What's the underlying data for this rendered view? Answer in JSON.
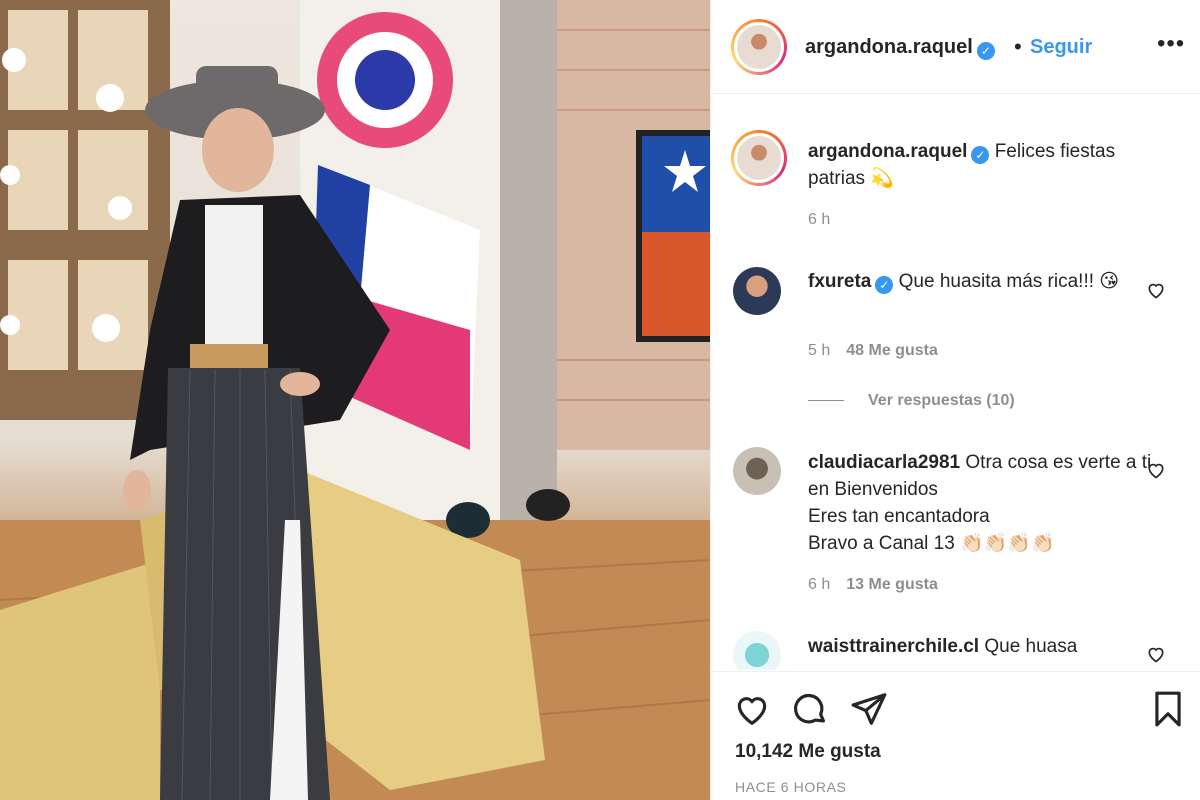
{
  "post": {
    "username": "argandona.raquel",
    "verified": true,
    "follow_label": "Seguir",
    "more_label": "•••",
    "dot": "•"
  },
  "caption": {
    "username": "argandona.raquel",
    "text": "Felices fiestas patrias 💫",
    "time": "6 h"
  },
  "comments": [
    {
      "username": "fxureta",
      "verified": true,
      "text": "Que huasita más rica!!! 😘",
      "time": "5 h",
      "likes": "48 Me gusta"
    },
    {
      "username": "claudiacarla2981",
      "verified": false,
      "text": "Otra cosa es verte a ti en Bienvenidos\nEres tan encantadora\nBravo a Canal 13 👏🏻👏🏻👏🏻👏🏻",
      "time": "6 h",
      "likes": "13 Me gusta"
    },
    {
      "username": "waisttrainerchile.cl",
      "verified": false,
      "text": "Que huasa"
    }
  ],
  "view_replies": "Ver respuestas (10)",
  "likes_count": "10,142 Me gusta",
  "posted_ago": "HACE 6 HORAS",
  "colors": {
    "link": "#3897f0",
    "text": "#262626",
    "muted": "#8e8e8e",
    "like": "#262626"
  }
}
